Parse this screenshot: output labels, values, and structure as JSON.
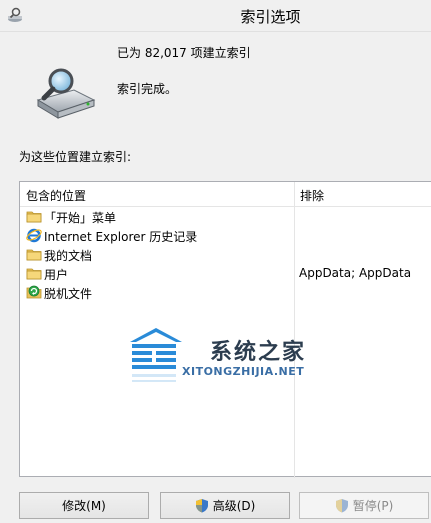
{
  "window": {
    "title": "索引选项",
    "title_icon": "indexing-options-icon"
  },
  "status": {
    "count_text": "已为 82,017 项建立索引",
    "state_text": "索引完成。",
    "icon": "drive-magnifier-icon"
  },
  "locations": {
    "section_label": "为这些位置建立索引:",
    "columns": {
      "included": "包含的位置",
      "excluded": "排除"
    },
    "rows": [
      {
        "label": "「开始」菜单",
        "excluded": "",
        "icon": "folder-icon"
      },
      {
        "label": "Internet Explorer 历史记录",
        "excluded": "",
        "icon": "internet-explorer-icon"
      },
      {
        "label": "我的文档",
        "excluded": "",
        "icon": "folder-icon"
      },
      {
        "label": "用户",
        "excluded": "AppData; AppData",
        "icon": "folder-icon"
      },
      {
        "label": "脱机文件",
        "excluded": "",
        "icon": "offline-files-icon"
      }
    ]
  },
  "watermark": {
    "cn": "系统之家",
    "en": "XITONGZHIJIA.NET"
  },
  "buttons": {
    "modify": "修改(M)",
    "advanced": "高级(D)",
    "pause": "暂停(P)"
  }
}
